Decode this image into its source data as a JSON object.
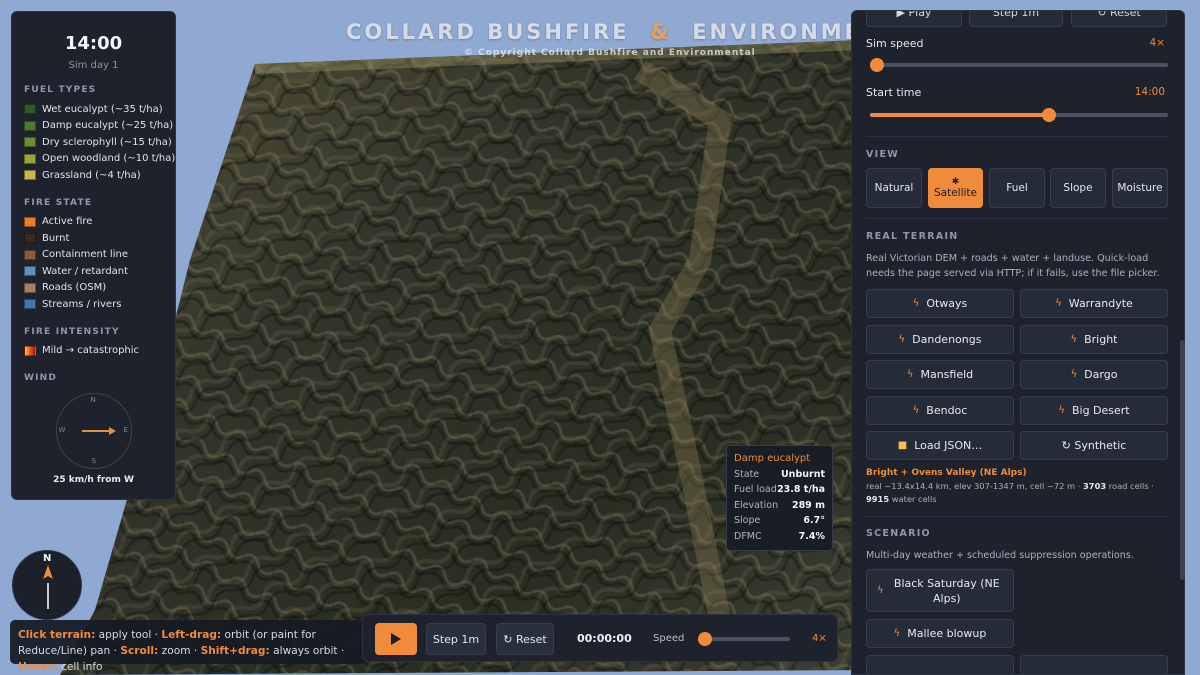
{
  "watermark": {
    "title_a": "COLLARD BUSHFIRE",
    "amp": "&",
    "title_b": "ENVIRONMENTAL",
    "copyright": "© Copyright Collard Bushfire and Environmental"
  },
  "legend": {
    "clock": "14:00",
    "sim_day": "Sim day 1",
    "fuel_types_heading": "FUEL TYPES",
    "fuel_types": [
      {
        "label": "Wet eucalypt (~35 t/ha)",
        "color": "#2e5a24"
      },
      {
        "label": "Damp eucalypt (~25 t/ha)",
        "color": "#4a7a2e"
      },
      {
        "label": "Dry sclerophyll (~15 t/ha)",
        "color": "#6f8a32"
      },
      {
        "label": "Open woodland (~10 t/ha)",
        "color": "#9aa33d"
      },
      {
        "label": "Grassland (~4 t/ha)",
        "color": "#c9b653"
      }
    ],
    "fire_state_heading": "FIRE STATE",
    "fire_state": [
      {
        "label": "Active fire",
        "color": "#f07a1e"
      },
      {
        "label": "Burnt",
        "color": "#3a2a22"
      },
      {
        "label": "Containment line",
        "color": "#8a5a3a"
      },
      {
        "label": "Water / retardant",
        "color": "#5b93b8"
      },
      {
        "label": "Roads (OSM)",
        "color": "#a08064"
      },
      {
        "label": "Streams / rivers",
        "color": "#3f77b2"
      }
    ],
    "fire_intensity_heading": "FIRE INTENSITY",
    "fire_intensity_label": "Mild → catastrophic",
    "wind_heading": "WIND",
    "compass": {
      "n": "N",
      "e": "E",
      "s": "S",
      "w": "W"
    },
    "wind_text": "25 km/h from W"
  },
  "north_arrow": {
    "label": "N"
  },
  "hint": {
    "k1": "Click terrain:",
    "t1": " apply tool · ",
    "k2": "Left-drag:",
    "t2": " orbit (or paint for Reduce/Line) pan · ",
    "k3": "Scroll:",
    "t3": " zoom · ",
    "k4": "Shift+drag:",
    "t4": " always orbit · ",
    "k5": "Hover:",
    "t5": " cell info"
  },
  "controls": {
    "step_label": "Step 1m",
    "reset_label": "↻ Reset",
    "timer": "00:00:00",
    "speed_label": "Speed",
    "speed_value": "4×",
    "speed_fraction": 0.0
  },
  "tooltip": {
    "title": "Damp eucalypt",
    "rows": [
      {
        "k": "State",
        "v": "Unburnt"
      },
      {
        "k": "Fuel load",
        "v": "23.8 t/ha"
      },
      {
        "k": "Elevation",
        "v": "289 m"
      },
      {
        "k": "Slope",
        "v": "6.7°"
      },
      {
        "k": "DFMC",
        "v": "7.4%"
      }
    ]
  },
  "panel": {
    "top_buttons": [
      "▶ Play",
      "Step 1m",
      "↻ Reset"
    ],
    "sim_speed_label": "Sim speed",
    "sim_speed_value": "4×",
    "sim_speed_fraction": 0.0,
    "start_time_label": "Start time",
    "start_time_value": "14:00",
    "start_time_fraction": 0.6,
    "view_heading": "VIEW",
    "views": [
      "Natural",
      "Satellite",
      "Fuel",
      "Slope",
      "Moisture"
    ],
    "active_view": "Satellite",
    "real_terrain_heading": "REAL TERRAIN",
    "real_terrain_desc": "Real Victorian DEM + roads + water + landuse. Quick-load needs the page served via HTTP; if it fails, use the file picker.",
    "terrains": [
      "Otways",
      "Warrandyte",
      "Dandenongs",
      "Bright",
      "Mansfield",
      "Dargo",
      "Bendoc",
      "Big Desert"
    ],
    "load_json_label": "Load JSON…",
    "synthetic_label": "↻ Synthetic",
    "loaded_title": "Bright + Ovens Valley (NE Alps)",
    "loaded_info_a": "real ~13.4x14.4 km, elev 307-1347 m, cell ~72 m · ",
    "loaded_roads": "3703",
    "loaded_info_b": " road cells · ",
    "loaded_water": "9915",
    "loaded_info_c": " water cells",
    "scenario_heading": "SCENARIO",
    "scenario_desc": "Multi-day weather + scheduled suppression operations.",
    "scenarios": [
      "Black Saturday (NE Alps)",
      "Mallee blowup"
    ]
  }
}
